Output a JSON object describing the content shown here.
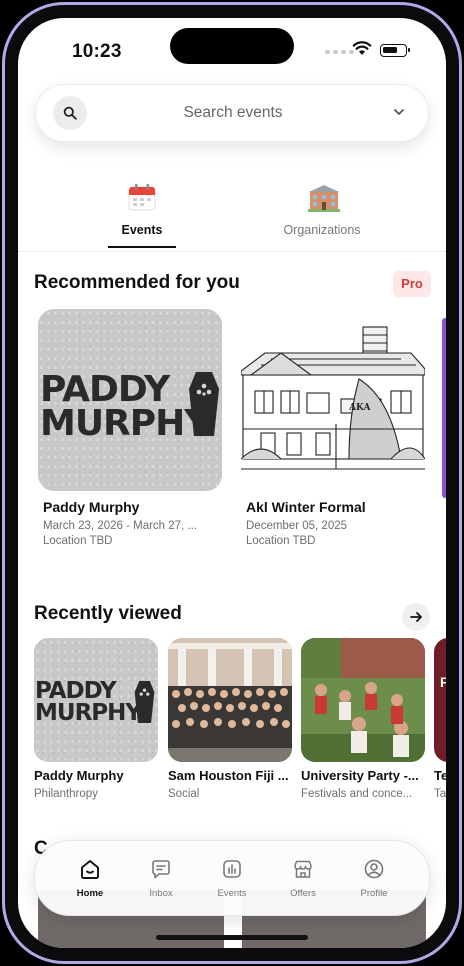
{
  "status_bar": {
    "time": "10:23"
  },
  "search": {
    "placeholder": "Search events"
  },
  "tabs": [
    {
      "label": "Events",
      "icon": "calendar-icon",
      "active": true
    },
    {
      "label": "Organizations",
      "icon": "building-icon",
      "active": false
    }
  ],
  "recommended": {
    "title": "Recommended for you",
    "badge": "Pro",
    "cards": [
      {
        "title": "Paddy Murphy",
        "date": "March 23, 2026 - March 27, ...",
        "location": "Location TBD",
        "image_text": [
          "PADDY",
          "MURPHY"
        ]
      },
      {
        "title": "Akl Winter Formal",
        "date": "December 05, 2025",
        "location": "Location TBD",
        "image_text": [
          "AKA"
        ]
      }
    ]
  },
  "recently_viewed": {
    "title": "Recently viewed",
    "cards": [
      {
        "title": "Paddy Murphy",
        "category": "Philanthropy",
        "image_text": [
          "PADDY",
          "MURPHY"
        ]
      },
      {
        "title": "Sam Houston Fiji ...",
        "category": "Social"
      },
      {
        "title": "University Party -...",
        "category": "Festivals and conce..."
      },
      {
        "title": "Te",
        "category": "Ta",
        "image_text": [
          "F"
        ]
      }
    ]
  },
  "third_section": {
    "title": "C"
  },
  "nav": [
    {
      "label": "Home",
      "icon": "home-icon",
      "active": true
    },
    {
      "label": "Inbox",
      "icon": "chat-icon",
      "active": false
    },
    {
      "label": "Events",
      "icon": "chart-icon",
      "active": false
    },
    {
      "label": "Offers",
      "icon": "store-icon",
      "active": false
    },
    {
      "label": "Profile",
      "icon": "profile-icon",
      "active": false
    }
  ],
  "colors": {
    "frame": "#b6a6e6",
    "pro_bg": "#fde7e7",
    "pro_text": "#d23b3b"
  }
}
